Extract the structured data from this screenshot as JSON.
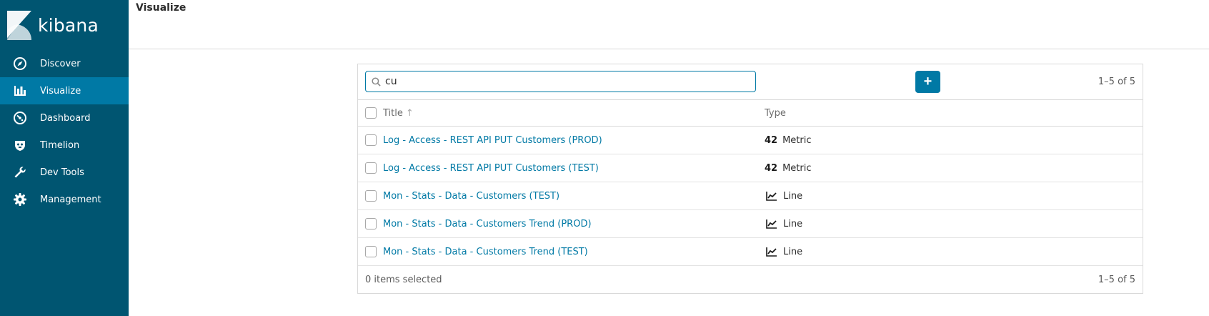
{
  "app": {
    "brand": "kibana",
    "page_title": "Visualize"
  },
  "sidebar": {
    "items": [
      {
        "label": "Discover",
        "icon": "compass-icon",
        "active": false
      },
      {
        "label": "Visualize",
        "icon": "bar-chart-icon",
        "active": true
      },
      {
        "label": "Dashboard",
        "icon": "speedometer-icon",
        "active": false
      },
      {
        "label": "Timelion",
        "icon": "shield-icon",
        "active": false
      },
      {
        "label": "Dev Tools",
        "icon": "wrench-icon",
        "active": false
      },
      {
        "label": "Management",
        "icon": "gear-icon",
        "active": false
      }
    ]
  },
  "toolbar": {
    "search_value": "cu",
    "add_label": "+",
    "pager": "1–5 of 5"
  },
  "table": {
    "columns": {
      "title": "Title",
      "type": "Type"
    },
    "rows": [
      {
        "title": "Log - Access - REST API PUT Customers (PROD)",
        "type_icon_text": "42",
        "type": "Metric"
      },
      {
        "title": "Log - Access - REST API PUT Customers (TEST)",
        "type_icon_text": "42",
        "type": "Metric"
      },
      {
        "title": "Mon - Stats - Data - Customers (TEST)",
        "type_icon_text": "",
        "type": "Line"
      },
      {
        "title": "Mon - Stats - Data - Customers Trend (PROD)",
        "type_icon_text": "",
        "type": "Line"
      },
      {
        "title": "Mon - Stats - Data - Customers Trend (TEST)",
        "type_icon_text": "",
        "type": "Line"
      }
    ]
  },
  "footer": {
    "selected": "0 items selected",
    "pager": "1–5 of 5"
  },
  "colors": {
    "sidebar": "#005571",
    "accent": "#0079a5",
    "active_item": "#0079a5"
  }
}
